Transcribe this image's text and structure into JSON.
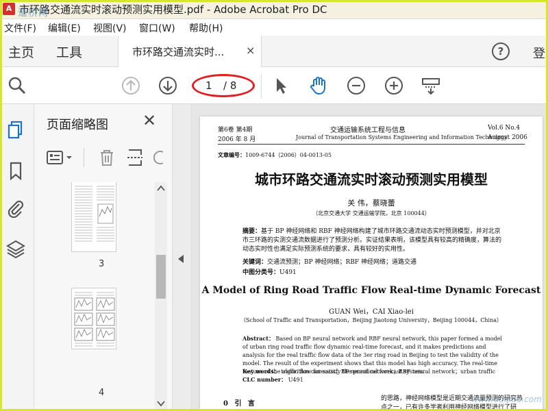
{
  "window": {
    "title": "市环路交通流实时滚动预测实用模型.pdf - Adobe Acrobat Pro DC",
    "watermark": "道桥网"
  },
  "menu": [
    "文件(F)",
    "编辑(E)",
    "视图(V)",
    "窗口(W)",
    "帮助(H)"
  ],
  "tabs": {
    "home": "主页",
    "tools": "工具",
    "document": "市环路交通流实时...",
    "close": "×",
    "help": "?",
    "login": "登"
  },
  "toolbar": {
    "current_page": "1",
    "total_pages": "/ 8"
  },
  "thumbnails": {
    "panel_title": "页面缩略图",
    "close": "✕",
    "pages": [
      "3",
      "4"
    ]
  },
  "document": {
    "header_left_1": "第6卷  第4期",
    "header_left_2": "2006 年 8 月",
    "header_center_1": "交通运输系统工程与信息",
    "header_center_2": "Journal of Transportation Systems Engineering and Information Technology",
    "header_right_1": "Vol.6   No.4",
    "header_right_2": "August   2006",
    "article_no_label": "文章编号：",
    "article_no": "1009-6744（2006）04-0013-05",
    "cn_title": "城市环路交通流实时滚动预测实用模型",
    "cn_authors": "关   伟，蔡晓蕾",
    "cn_affiliation": "（北京交通大学 交通运输学院，北京 100044）",
    "cn_abstract_label": "摘要：",
    "cn_abstract": "基于 BP 神经网络和 RBF 神经网络构建了城市环路交通流动态实时预测模型，并对北京市三环路的实测交通流数据进行了预测分析。实证结果表明，该模型具有较高的精确度，算法的动态实时性也满足实际预测系统的要求，具有较好的实用性。",
    "cn_keywords_label": "关键词：",
    "cn_keywords": "交通流预测；BP 神经网络；RBF 神经网络；道路交通",
    "cn_clc_label": "中图分类号：",
    "cn_clc": "U491",
    "en_title": "A Model of Ring Road Traffic Flow Real-time Dynamic Forecast",
    "en_authors": "GUAN Wei，CAI Xiao-lei",
    "en_affiliation": "（School of Traffic and Transportation，Beijing Jiaotong University，Beijing 100044，China）",
    "en_abstract_label": "Abstract：",
    "en_abstract": "Based on BP neural network and RBF neural network, this paper formed a model of urban ring road traffic flow dynamic real-time forecast, and it makes predictions and analysis for the real traffic flow data of the 3er ring road in Beijing to test the validity of the model. The result of the experiment shows that this model has high accuracy. The real-time feature of the algorithm can satisfy the practical forecast system.",
    "en_keywords_label": "Key words：",
    "en_keywords": "traffic flow forecast；BP neural network；RBF neural network；urban traffic",
    "en_clc_label": "CLC number：",
    "en_clc": "U491",
    "section_0": "0  引    言",
    "body_right": "的思路，神经网络模型是近期交通流量预测的研究热点之一，已有许多学者利用神经网络模型进行了研究。"
  },
  "site_watermark": "www.ddqiao.com",
  "colors": {
    "annotation_ellipse": "#e02020",
    "frame": "#d6e62a",
    "accent_blue": "#1a73c8"
  }
}
